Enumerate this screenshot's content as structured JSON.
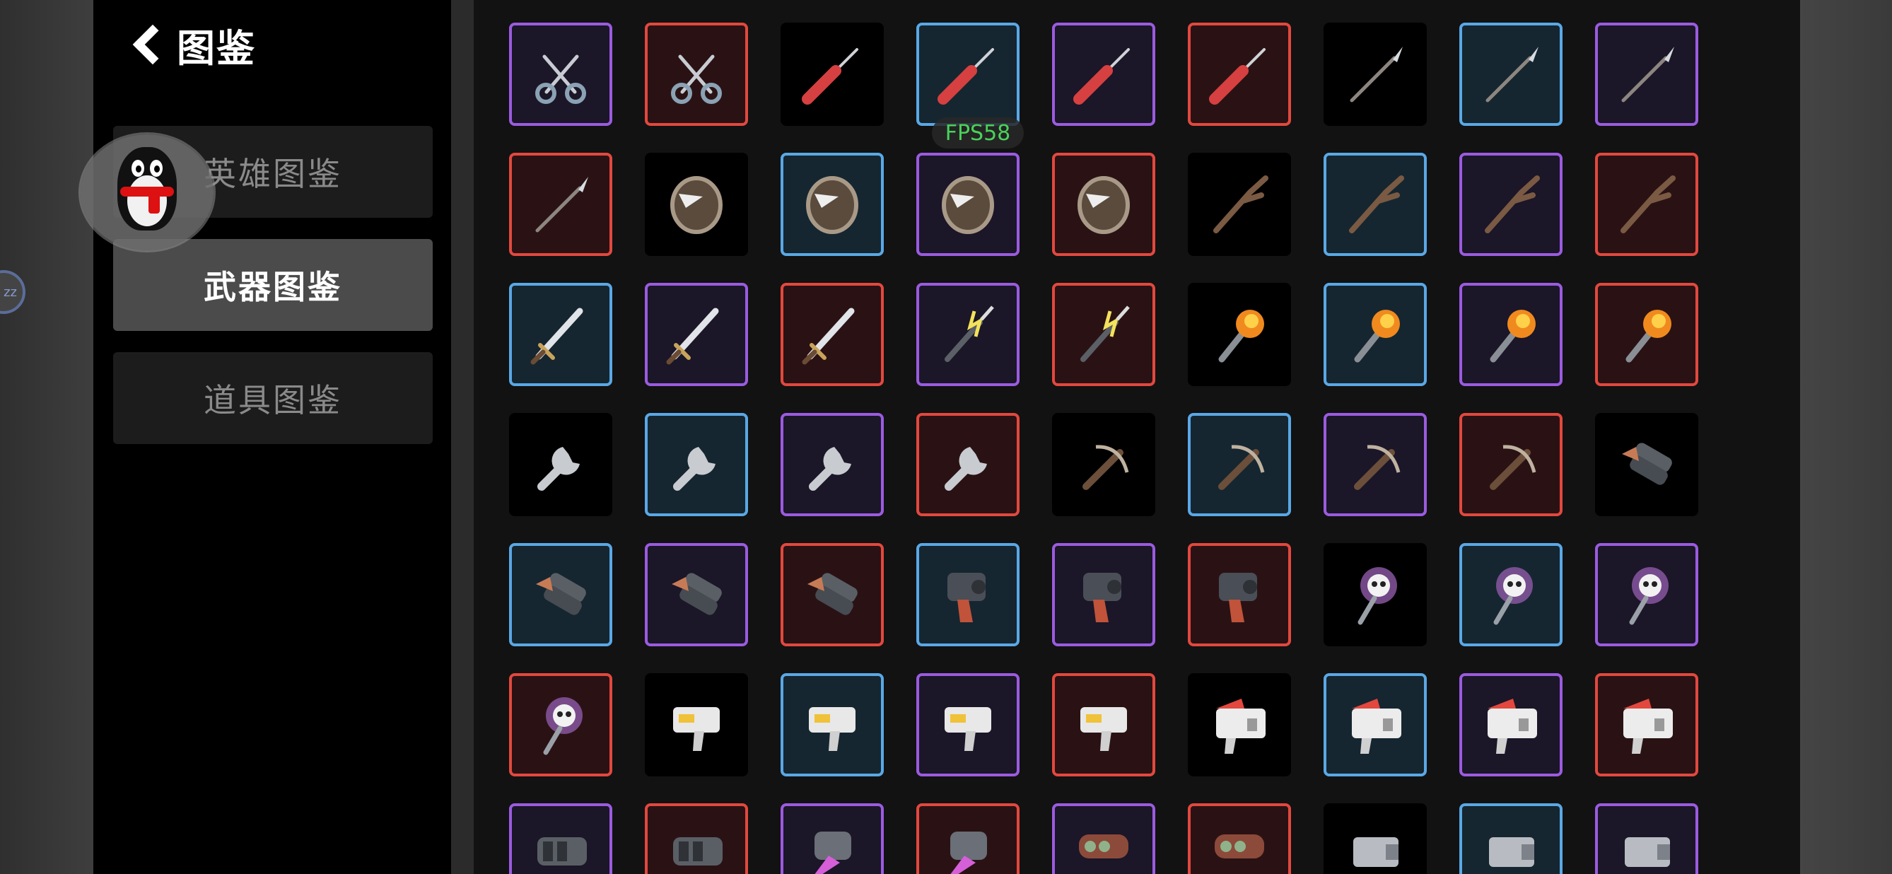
{
  "header": {
    "title": "图鉴"
  },
  "sidebar": {
    "menu": [
      {
        "label": "英雄图鉴",
        "selected": false
      },
      {
        "label": "武器图鉴",
        "selected": true
      },
      {
        "label": "道具图鉴",
        "selected": false
      }
    ]
  },
  "overlay": {
    "fps": "FPS58",
    "avatar": "qq-penguin-icon"
  },
  "colors": {
    "blue": "#5aa8e6",
    "purple": "#9b5be0",
    "red": "#e2483e",
    "selected_menu": "#4b4b4b"
  },
  "weapons": [
    {
      "icon": "scissors",
      "rarity": "purple"
    },
    {
      "icon": "scissors",
      "rarity": "red"
    },
    {
      "icon": "screwdriver",
      "rarity": "black"
    },
    {
      "icon": "screwdriver",
      "rarity": "blue"
    },
    {
      "icon": "screwdriver",
      "rarity": "purple"
    },
    {
      "icon": "screwdriver",
      "rarity": "red"
    },
    {
      "icon": "spear",
      "rarity": "black"
    },
    {
      "icon": "spear",
      "rarity": "blue"
    },
    {
      "icon": "spear",
      "rarity": "purple"
    },
    {
      "icon": "spear",
      "rarity": "red"
    },
    {
      "icon": "shield",
      "rarity": "black"
    },
    {
      "icon": "shield",
      "rarity": "blue"
    },
    {
      "icon": "shield",
      "rarity": "purple"
    },
    {
      "icon": "shield",
      "rarity": "red"
    },
    {
      "icon": "branch",
      "rarity": "black"
    },
    {
      "icon": "branch",
      "rarity": "blue"
    },
    {
      "icon": "branch",
      "rarity": "purple"
    },
    {
      "icon": "branch",
      "rarity": "red"
    },
    {
      "icon": "sword",
      "rarity": "blue"
    },
    {
      "icon": "sword",
      "rarity": "purple"
    },
    {
      "icon": "sword",
      "rarity": "red"
    },
    {
      "icon": "lightning-spear",
      "rarity": "purple"
    },
    {
      "icon": "lightning-spear",
      "rarity": "red"
    },
    {
      "icon": "torch",
      "rarity": "black"
    },
    {
      "icon": "torch",
      "rarity": "blue"
    },
    {
      "icon": "torch",
      "rarity": "purple"
    },
    {
      "icon": "torch",
      "rarity": "red"
    },
    {
      "icon": "wrench",
      "rarity": "black"
    },
    {
      "icon": "wrench",
      "rarity": "blue"
    },
    {
      "icon": "wrench",
      "rarity": "purple"
    },
    {
      "icon": "wrench",
      "rarity": "red"
    },
    {
      "icon": "crossbow",
      "rarity": "black"
    },
    {
      "icon": "crossbow",
      "rarity": "blue"
    },
    {
      "icon": "crossbow",
      "rarity": "purple"
    },
    {
      "icon": "crossbow",
      "rarity": "red"
    },
    {
      "icon": "double-barrel",
      "rarity": "black"
    },
    {
      "icon": "double-barrel",
      "rarity": "blue"
    },
    {
      "icon": "double-barrel",
      "rarity": "purple"
    },
    {
      "icon": "double-barrel",
      "rarity": "red"
    },
    {
      "icon": "pistol",
      "rarity": "blue"
    },
    {
      "icon": "pistol",
      "rarity": "purple"
    },
    {
      "icon": "pistol",
      "rarity": "red"
    },
    {
      "icon": "skull-wand",
      "rarity": "black"
    },
    {
      "icon": "skull-wand",
      "rarity": "blue"
    },
    {
      "icon": "skull-wand",
      "rarity": "purple"
    },
    {
      "icon": "skull-wand",
      "rarity": "red"
    },
    {
      "icon": "laser-gun",
      "rarity": "black"
    },
    {
      "icon": "laser-gun",
      "rarity": "blue"
    },
    {
      "icon": "laser-gun",
      "rarity": "purple"
    },
    {
      "icon": "laser-gun",
      "rarity": "red"
    },
    {
      "icon": "blaster",
      "rarity": "black"
    },
    {
      "icon": "blaster",
      "rarity": "blue"
    },
    {
      "icon": "blaster",
      "rarity": "purple"
    },
    {
      "icon": "blaster",
      "rarity": "red"
    },
    {
      "icon": "minigun",
      "rarity": "purple"
    },
    {
      "icon": "minigun",
      "rarity": "red"
    },
    {
      "icon": "plasma-cannon",
      "rarity": "purple"
    },
    {
      "icon": "plasma-cannon",
      "rarity": "red"
    },
    {
      "icon": "rocket-launcher",
      "rarity": "purple"
    },
    {
      "icon": "rocket-launcher",
      "rarity": "red"
    },
    {
      "icon": "heavy-cannon",
      "rarity": "black"
    },
    {
      "icon": "heavy-cannon",
      "rarity": "blue"
    },
    {
      "icon": "heavy-cannon",
      "rarity": "purple"
    }
  ]
}
